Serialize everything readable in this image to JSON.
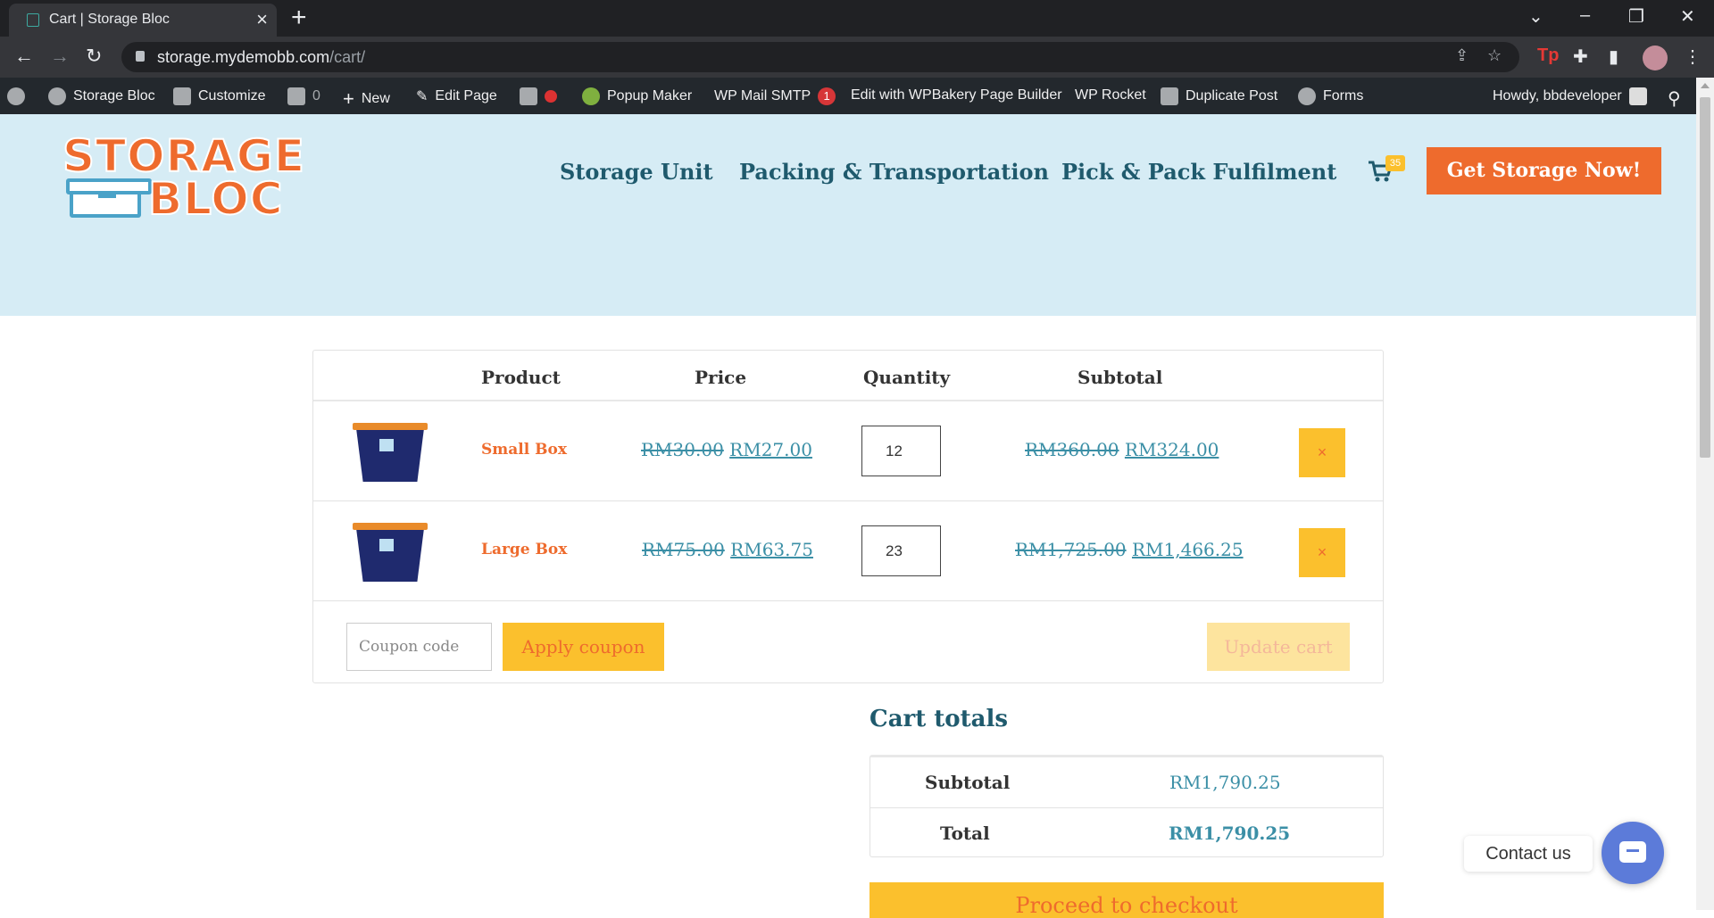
{
  "browser": {
    "tab_title": "Cart | Storage Bloc",
    "url_host": "storage.mydemobb.com",
    "url_path": "/cart/"
  },
  "wp_admin_bar": {
    "site_name": "Storage Bloc",
    "customize": "Customize",
    "comments_count": "0",
    "new": "New",
    "edit_page": "Edit Page",
    "popup_maker": "Popup Maker",
    "wp_mail_smtp": "WP Mail SMTP",
    "wp_mail_badge": "1",
    "wpbakery": "Edit with WPBakery Page Builder",
    "wp_rocket": "WP Rocket",
    "duplicate_post": "Duplicate Post",
    "forms": "Forms",
    "howdy": "Howdy, bbdeveloper"
  },
  "header": {
    "logo_line1": "STORAGE",
    "logo_line2": "BLOC",
    "nav": [
      "Storage Unit",
      "Packing & Transportation",
      "Pick & Pack Fulfilment"
    ],
    "cart_count": "35",
    "cta": "Get Storage Now!"
  },
  "cart": {
    "columns": {
      "product": "Product",
      "price": "Price",
      "quantity": "Quantity",
      "subtotal": "Subtotal"
    },
    "items": [
      {
        "name": "Small Box",
        "price_old": "RM30.00",
        "price_new": "RM27.00",
        "qty": "12",
        "subtotal_old": "RM360.00",
        "subtotal_new": "RM324.00",
        "remove": "×"
      },
      {
        "name": "Large Box",
        "price_old": "RM75.00",
        "price_new": "RM63.75",
        "qty": "23",
        "subtotal_old": "RM1,725.00",
        "subtotal_new": "RM1,466.25",
        "remove": "×"
      }
    ],
    "coupon_placeholder": "Coupon code",
    "apply_coupon": "Apply coupon",
    "update_cart": "Update cart"
  },
  "totals": {
    "title": "Cart totals",
    "subtotal_label": "Subtotal",
    "subtotal_value": "RM1,790.25",
    "total_label": "Total",
    "total_value": "RM1,790.25",
    "checkout": "Proceed to checkout"
  },
  "contact": {
    "label": "Contact us"
  },
  "colors": {
    "accent": "#ee6b2d",
    "yellow": "#fbc02d",
    "teal": "#1f5a6d",
    "link": "#3b8fa6",
    "header_bg": "#d6ecf5"
  }
}
